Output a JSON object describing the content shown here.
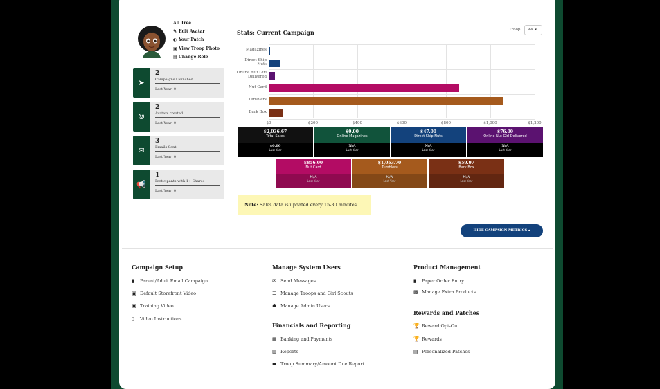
{
  "profile": {
    "name": "Ali Tree",
    "links": [
      {
        "icon": "pencil-icon",
        "glyph": "✎",
        "label": "Edit Avatar"
      },
      {
        "icon": "patch-icon",
        "glyph": "◐",
        "label": "Your Patch"
      },
      {
        "icon": "photo-icon",
        "glyph": "▣",
        "label": "View Troop Photo"
      },
      {
        "icon": "role-icon",
        "glyph": "▤",
        "label": "Change Role"
      }
    ]
  },
  "stats": [
    {
      "icon": "rocket-icon",
      "glyph": "➤",
      "value": "2",
      "label": "Campaigns Launched",
      "last_year": "Last Year: 0"
    },
    {
      "icon": "avatar-created-icon",
      "glyph": "☺",
      "value": "2",
      "label": "Avatars created",
      "last_year": "Last Year: 0"
    },
    {
      "icon": "envelope-icon",
      "glyph": "✉",
      "value": "3",
      "label": "Emails Sent",
      "last_year": "Last Year: 0"
    },
    {
      "icon": "megaphone-icon",
      "glyph": "📢",
      "value": "1",
      "label": "Participants with 1+ Shares",
      "last_year": "Last Year: 0"
    }
  ],
  "chart_header": {
    "title": "Stats: Current Campaign",
    "troop_label": "Troop:",
    "troop_value": "44"
  },
  "chart_data": {
    "type": "bar",
    "orientation": "horizontal",
    "categories": [
      "Magazines",
      "Direct Ship Nuts",
      "Online Nut Girl Delivered",
      "Nut Card",
      "Tumblers",
      "Bark Box"
    ],
    "values": [
      0,
      47,
      26,
      856,
      1053,
      60
    ],
    "colors": [
      "#13427c",
      "#13427c",
      "#5b1270",
      "#b30c64",
      "#a55a1d",
      "#7a3015"
    ],
    "x_ticks": [
      "$0",
      "$200",
      "$400",
      "$600",
      "$800",
      "$1,000",
      "$1,200"
    ],
    "xlim": [
      0,
      1200
    ],
    "grid": true
  },
  "tiles": [
    {
      "value": "$2,036.67",
      "label": "Total Sales",
      "ly_value": "$0.00",
      "ly_label": "Last Year",
      "color": "#111111"
    },
    {
      "value": "$0.00",
      "label": "Online Magazines",
      "ly_value": "N/A",
      "ly_label": "Last Year",
      "color": "#11533b"
    },
    {
      "value": "$47.00",
      "label": "Direct Ship Nuts",
      "ly_value": "N/A",
      "ly_label": "Last Year",
      "color": "#13427c"
    },
    {
      "value": "$76.00",
      "label": "Online Nut Girl Delivered",
      "ly_value": "N/A",
      "ly_label": "Last Year",
      "color": "#5b1270"
    },
    {
      "value": "$856.00",
      "label": "Nut Card",
      "ly_value": "N/A",
      "ly_label": "Last Year",
      "color": "#b30c64"
    },
    {
      "value": "$1,053.70",
      "label": "Tumblers",
      "ly_value": "N/A",
      "ly_label": "Last Year",
      "color": "#a55a1d"
    },
    {
      "value": "$59.97",
      "label": "Bark Box",
      "ly_value": "N/A",
      "ly_label": "Last Year",
      "color": "#7a3015"
    }
  ],
  "note": {
    "bold": "Note:",
    "text": " Sales data is updated every 15-30 minutes."
  },
  "hide_button": "HIDE CAMPAIGN METRICS ▴",
  "menus": {
    "campaign_setup": {
      "title": "Campaign Setup",
      "items": [
        {
          "icon": "document-icon",
          "glyph": "▮",
          "label": "Parent/Adult Email Campaign"
        },
        {
          "icon": "video-icon",
          "glyph": "▣",
          "label": "Default Storefront Video"
        },
        {
          "icon": "video-icon",
          "glyph": "▣",
          "label": "Training Video"
        },
        {
          "icon": "file-icon",
          "glyph": "▯",
          "label": "Video Instructions"
        }
      ]
    },
    "manage_users": {
      "title": "Manage System Users",
      "items": [
        {
          "icon": "envelope-icon",
          "glyph": "✉",
          "label": "Send Messages"
        },
        {
          "icon": "list-icon",
          "glyph": "☰",
          "label": "Manage Troops and Girl Scouts"
        },
        {
          "icon": "users-icon",
          "glyph": "☗",
          "label": "Manage Admin Users"
        }
      ]
    },
    "financials": {
      "title": "Financials and Reporting",
      "items": [
        {
          "icon": "bank-icon",
          "glyph": "▦",
          "label": "Banking and Payments"
        },
        {
          "icon": "chart-icon",
          "glyph": "▥",
          "label": "Reports"
        },
        {
          "icon": "folder-icon",
          "glyph": "▬",
          "label": "Troop Summary/Amount Due Report"
        }
      ]
    },
    "product_management": {
      "title": "Product Management",
      "items": [
        {
          "icon": "paper-icon",
          "glyph": "▮",
          "label": "Paper Order Entry"
        },
        {
          "icon": "box-icon",
          "glyph": "▩",
          "label": "Manage Extra Products"
        }
      ]
    },
    "rewards": {
      "title": "Rewards and Patches",
      "items": [
        {
          "icon": "trophy-icon",
          "glyph": "🏆",
          "label": "Reward Opt-Out"
        },
        {
          "icon": "trophy-icon",
          "glyph": "🏆",
          "label": "Rewards"
        },
        {
          "icon": "patch-list-icon",
          "glyph": "▤",
          "label": "Personalized Patches"
        }
      ]
    }
  }
}
